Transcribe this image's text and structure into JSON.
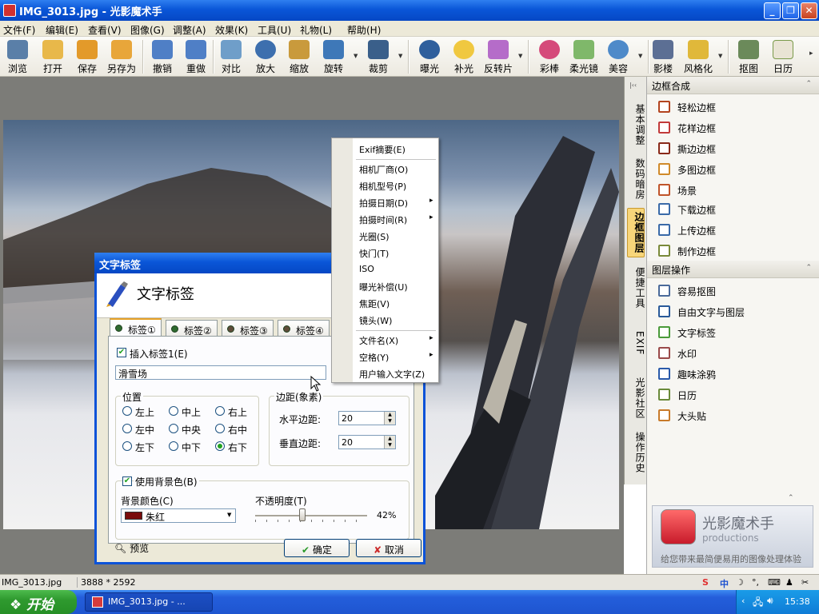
{
  "window": {
    "title": "IMG_3013.jpg - 光影魔术手"
  },
  "menu": [
    "文件(F)",
    "编辑(E)",
    "查看(V)",
    "图像(G)",
    "调整(A)",
    "效果(K)",
    "工具(U)",
    "礼物(L)",
    "帮助(H)"
  ],
  "toolbar": [
    "浏览",
    "打开",
    "保存",
    "另存为",
    "撤销",
    "重做",
    "对比",
    "放大",
    "缩放",
    "旋转",
    "裁剪",
    "曝光",
    "补光",
    "反转片",
    "彩棒",
    "柔光镜",
    "美容",
    "影楼",
    "风格化",
    "抠图",
    "日历"
  ],
  "side_tabs": [
    "基本调整",
    "数码暗房",
    "边框图层",
    "便捷工具",
    "EXIF",
    "光影社区",
    "操作历史"
  ],
  "panel": {
    "sections": [
      {
        "title": "边框合成",
        "items": [
          "轻松边框",
          "花样边框",
          "撕边边框",
          "多图边框",
          "场景",
          "下载边框",
          "上传边框",
          "制作边框"
        ]
      },
      {
        "title": "图层操作",
        "items": [
          "容易抠图",
          "自由文字与图层",
          "文字标签",
          "水印",
          "趣味涂鸦",
          "日历",
          "大头贴"
        ]
      }
    ],
    "promo": {
      "name": "光影魔术手",
      "sub": "productions",
      "slogan": "给您带来最简便易用的图像处理体验"
    }
  },
  "dialog": {
    "title": "文字标签",
    "header": "文字标签",
    "tabs": [
      "标签①",
      "标签②",
      "标签③",
      "标签④"
    ],
    "insert_label": "插入标签1(E)",
    "text_value": "滑雪场",
    "position_legend": "位置",
    "positions": [
      "左上",
      "中上",
      "右上",
      "左中",
      "中央",
      "右中",
      "左下",
      "中下",
      "右下"
    ],
    "selected_position": "右下",
    "margin_legend": "边距(象素)",
    "h_margin_label": "水平边距:",
    "h_margin": "20",
    "v_margin_label": "垂直边距:",
    "v_margin": "20",
    "use_bg": "使用背景色(B)",
    "bg_color_label": "背景颜色(C)",
    "bg_color_name": "朱红",
    "bg_color": "#7a0c0c",
    "opacity_label": "不透明度(T)",
    "opacity": "42%",
    "preview": "预览",
    "ok": "确定",
    "cancel": "取消"
  },
  "context_menu": [
    "Exif摘要(E)",
    "相机厂商(O)",
    "相机型号(P)",
    "拍摄日期(D)",
    "拍摄时间(R)",
    "光圈(S)",
    "快门(T)",
    "ISO",
    "曝光补偿(U)",
    "焦距(V)",
    "镜头(W)",
    "文件名(X)",
    "空格(Y)",
    "用户输入文字(Z)"
  ],
  "status": {
    "filename": "IMG_3013.jpg",
    "dimensions": "3888 * 2592"
  },
  "taskbar": {
    "start": "开始",
    "task": "IMG_3013.jpg - ...",
    "time": "15:38"
  }
}
